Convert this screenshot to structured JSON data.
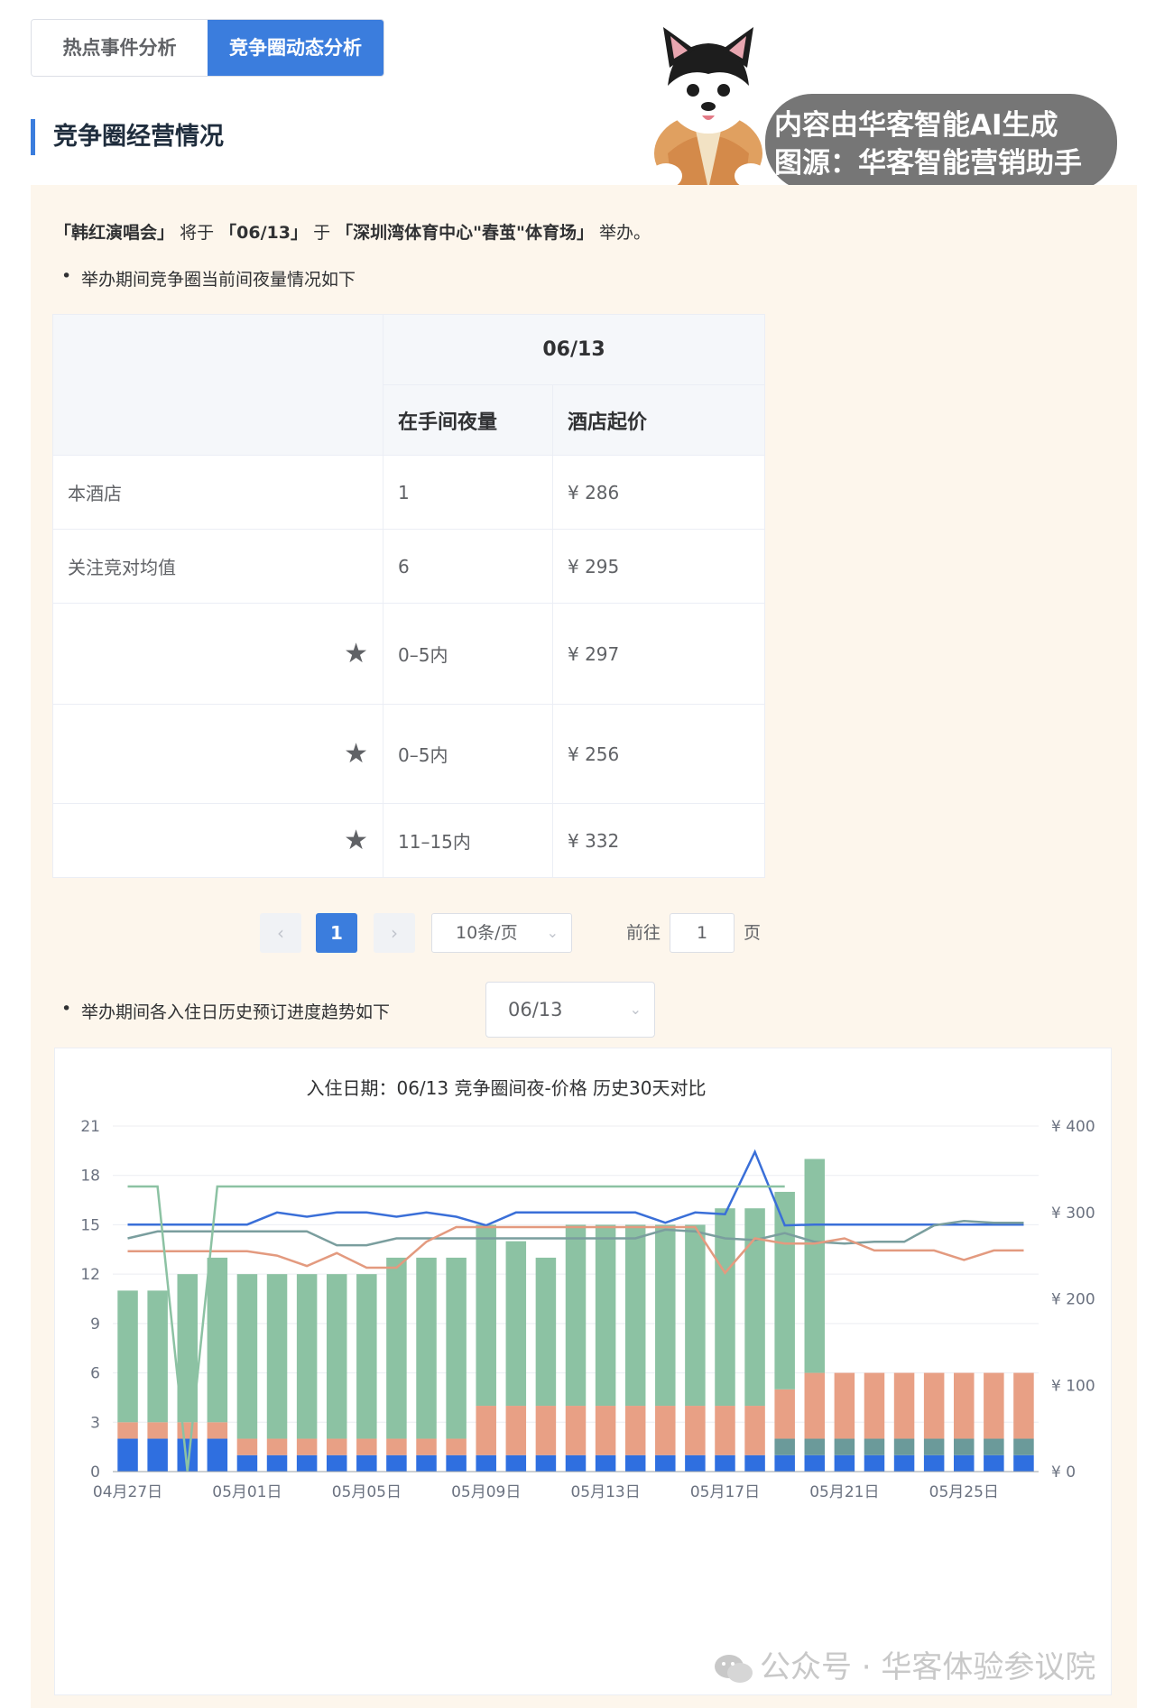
{
  "tabs": [
    {
      "label": "热点事件分析",
      "active": false
    },
    {
      "label": "竞争圈动态分析",
      "active": true
    }
  ],
  "section_title": "竞争圈经营情况",
  "watermark": {
    "line1": "内容由华客智能AI生成",
    "line2": "图源：华客智能营销助手"
  },
  "event": {
    "open1": "「",
    "name": "韩红演唱会",
    "close1": "」",
    "t1": "将于",
    "open2": "「",
    "date": "06/13",
    "close2": "」",
    "t2": "于",
    "open3": "「",
    "venue": "深圳湾体育中心\"春茧\"体育场",
    "close3": "」",
    "t3": "举办。"
  },
  "bullet1": "举办期间竞争圈当前间夜量情况如下",
  "bullet2": "举办期间各入住日历史预订进度趋势如下",
  "table": {
    "date_header": "06/13",
    "col1": "在手间夜量",
    "col2": "酒店起价",
    "rows": [
      {
        "name": "本酒店",
        "nights": "1",
        "price": "¥ 286"
      },
      {
        "name": "关注竞对均值",
        "nights": "6",
        "price": "¥ 295"
      },
      {
        "name": "",
        "nights": "0–5内",
        "price": "¥ 297"
      },
      {
        "name": "",
        "nights": "0–5内",
        "price": "¥ 256"
      },
      {
        "name": "",
        "nights": "11–15内",
        "price": "¥ 332"
      }
    ]
  },
  "pager": {
    "prev": "‹",
    "current": "1",
    "next": "›",
    "page_size": "10条/页",
    "goto_label": "前往",
    "goto_value": "1",
    "goto_suffix": "页"
  },
  "date_select": "06/13",
  "chart_data": {
    "type": "bar",
    "title": "入住日期：06/13 竞争圈间夜-价格 历史30天对比",
    "categories": [
      "04月27日",
      "04月28日",
      "04月29日",
      "04月30日",
      "05月01日",
      "05月02日",
      "05月03日",
      "05月04日",
      "05月05日",
      "05月06日",
      "05月07日",
      "05月08日",
      "05月09日",
      "05月10日",
      "05月11日",
      "05月12日",
      "05月13日",
      "05月14日",
      "05月15日",
      "05月16日",
      "05月17日",
      "05月18日",
      "05月19日",
      "05月20日",
      "05月21日",
      "05月22日",
      "05月23日",
      "05月24日",
      "05月25日",
      "05月26日",
      "05月27日"
    ],
    "x_tick_labels": [
      "04月27日",
      "05月01日",
      "05月05日",
      "05月09日",
      "05月13日",
      "05月17日",
      "05月21日",
      "05月25日"
    ],
    "y_left": {
      "min": 0,
      "max": 21,
      "ticks": [
        0,
        3,
        6,
        9,
        12,
        15,
        18,
        21
      ]
    },
    "y_right": {
      "min": 0,
      "max": 400,
      "ticks": [
        "¥ 0",
        "¥ 100",
        "¥ 200",
        "¥ 300",
        "¥ 400"
      ]
    },
    "bar_colors": [
      "#2f6fe0",
      "#6b9a9a",
      "#e8a085",
      "#8cc2a3"
    ],
    "stacks": [
      [
        2,
        2,
        2,
        2,
        1,
        1,
        1,
        1,
        1,
        1,
        1,
        1,
        1,
        1,
        1,
        1,
        1,
        1,
        1,
        1,
        1,
        1,
        1,
        1,
        1,
        1,
        1,
        1,
        1,
        1,
        1
      ],
      [
        0,
        0,
        0,
        0,
        0,
        0,
        0,
        0,
        0,
        0,
        0,
        0,
        0,
        0,
        0,
        0,
        0,
        0,
        0,
        0,
        0,
        0,
        1,
        1,
        1,
        1,
        1,
        1,
        1,
        1,
        1
      ],
      [
        1,
        1,
        1,
        1,
        1,
        1,
        1,
        1,
        1,
        1,
        1,
        1,
        3,
        3,
        3,
        3,
        3,
        3,
        3,
        3,
        3,
        3,
        3,
        4,
        4,
        4,
        4,
        4,
        4,
        4,
        4
      ],
      [
        8,
        8,
        9,
        10,
        10,
        10,
        10,
        10,
        10,
        11,
        11,
        11,
        11,
        10,
        9,
        11,
        11,
        11,
        11,
        11,
        12,
        12,
        12,
        13,
        0,
        0,
        0,
        0,
        0,
        0,
        0
      ]
    ],
    "lines": [
      {
        "color": "#3a6fd8",
        "values": [
          286,
          286,
          286,
          286,
          286,
          300,
          295,
          300,
          300,
          295,
          300,
          295,
          285,
          300,
          300,
          300,
          300,
          300,
          288,
          300,
          298,
          370,
          285,
          286,
          286,
          286,
          286,
          286,
          286,
          286,
          286
        ]
      },
      {
        "color": "#7a9e9e",
        "values": [
          270,
          278,
          278,
          278,
          278,
          278,
          278,
          262,
          262,
          270,
          270,
          270,
          270,
          270,
          270,
          270,
          270,
          270,
          280,
          278,
          270,
          268,
          276,
          266,
          264,
          266,
          266,
          285,
          290,
          288,
          288
        ]
      },
      {
        "color": "#e39a7f",
        "values": [
          255,
          255,
          255,
          255,
          255,
          250,
          238,
          253,
          236,
          236,
          266,
          283,
          283,
          283,
          283,
          283,
          283,
          283,
          283,
          283,
          230,
          270,
          264,
          264,
          270,
          256,
          256,
          256,
          245,
          256,
          256
        ]
      },
      {
        "color": "#8cc2a3",
        "values": [
          330,
          330,
          0,
          330,
          330,
          330,
          330,
          330,
          330,
          330,
          330,
          330,
          330,
          330,
          330,
          330,
          330,
          330,
          330,
          330,
          330,
          330,
          330
        ]
      }
    ]
  },
  "footer_watermark": "公众号 · 华客体验参议院"
}
